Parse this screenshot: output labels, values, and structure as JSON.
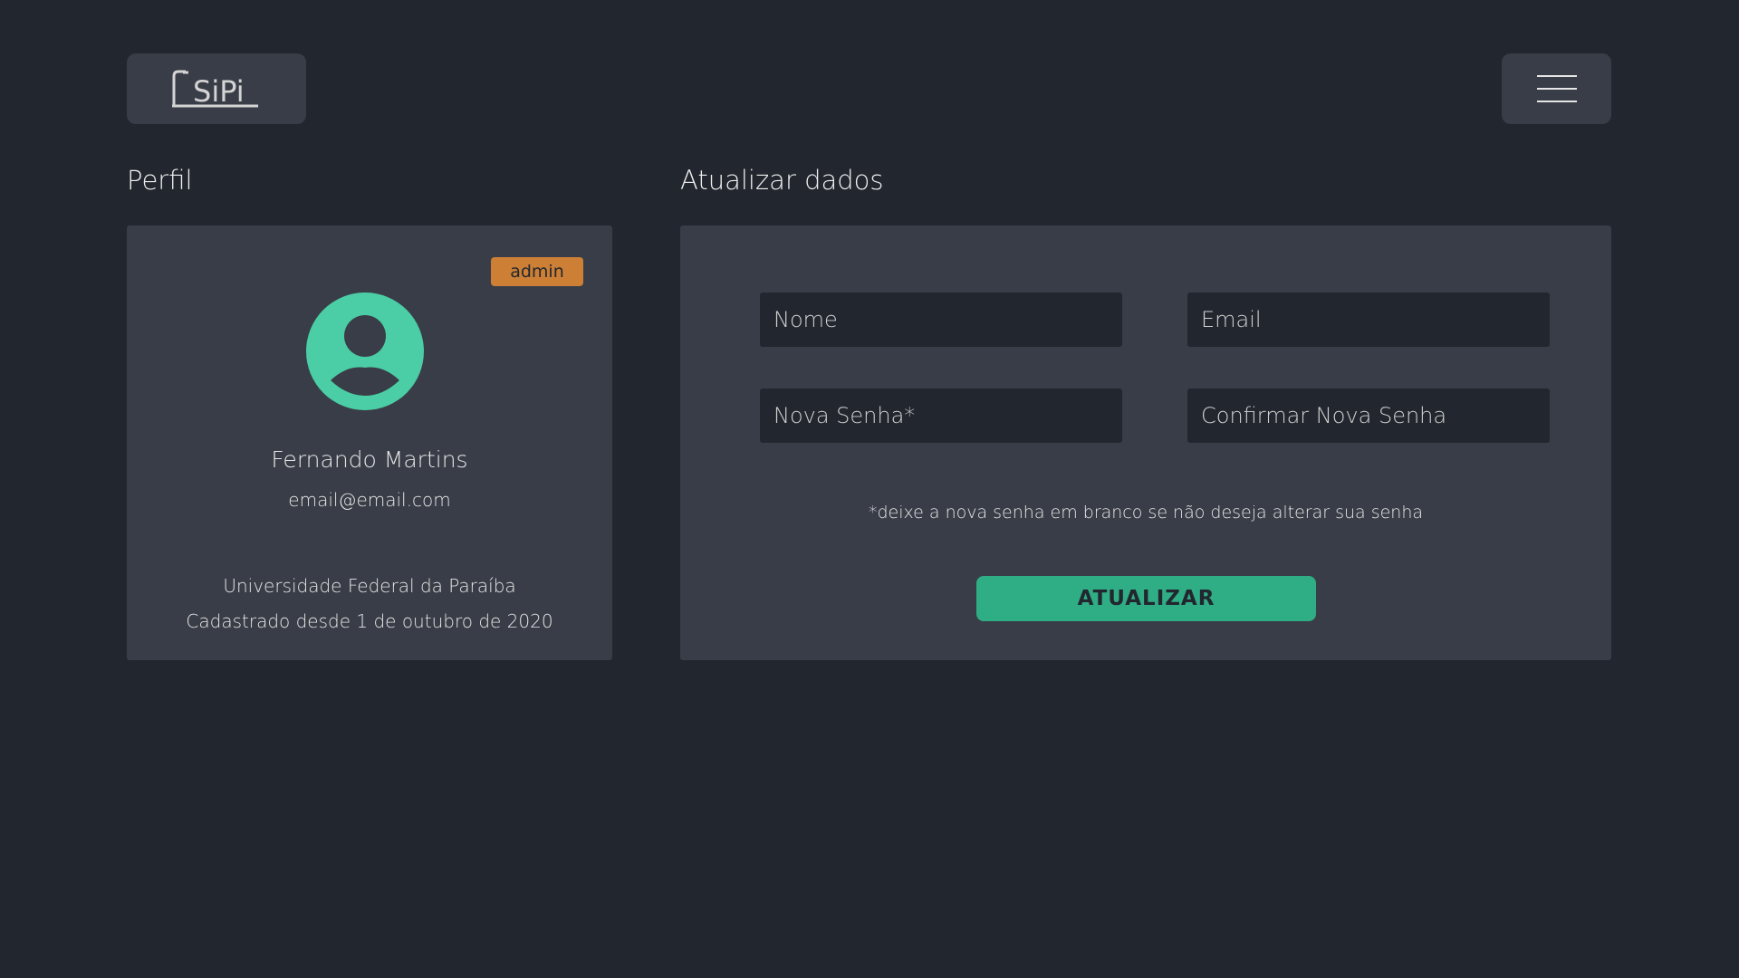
{
  "header": {
    "logo_text": "SiPi",
    "menu_icon": "hamburger-icon"
  },
  "profile": {
    "title": "Perfil",
    "role_badge": "admin",
    "name": "Fernando Martins",
    "email": "email@email.com",
    "institution": "Universidade Federal da Paraíba",
    "registered": "Cadastrado desde 1 de outubro de 2020"
  },
  "update": {
    "title": "Atualizar dados",
    "fields": {
      "name_placeholder": "Nome",
      "email_placeholder": "Email",
      "new_password_placeholder": "Nova Senha*",
      "confirm_password_placeholder": "Confirmar Nova Senha"
    },
    "note": "*deixe a nova senha em branco se não deseja alterar sua senha",
    "submit_label": "ATUALIZAR"
  },
  "colors": {
    "background": "#22272f",
    "card": "#393d47",
    "accent": "#4bcea5",
    "button": "#2fae85",
    "badge": "#cd8035"
  }
}
